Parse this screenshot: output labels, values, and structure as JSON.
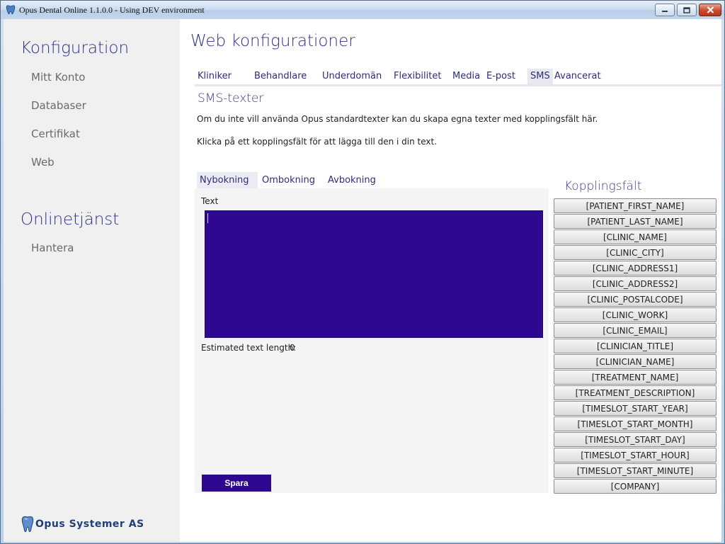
{
  "window": {
    "title": "Opus Dental Online 1.1.0.0 - Using DEV environment"
  },
  "sidebar": {
    "section1_heading": "Konfiguration",
    "section1_items": [
      "Mitt Konto",
      "Databaser",
      "Certifikat",
      "Web"
    ],
    "section2_heading": "Onlinetjänst",
    "section2_items": [
      "Hantera"
    ],
    "brand": "Opus Systemer AS"
  },
  "main": {
    "title": "Web konfigurationer",
    "tabs": [
      "Kliniker",
      "Behandlare",
      "Underdomän",
      "Flexibilitet",
      "Media",
      "E-post",
      "SMS",
      "Avancerat"
    ],
    "active_tab": "SMS",
    "section_title": "SMS-texter",
    "description1": "Om du inte vill använda Opus standardtexter kan du skapa egna texter med kopplingsfält här.",
    "description2": "Klicka på ett kopplingsfält för att lägga till den i din text.",
    "subtabs": [
      "Nybokning",
      "Ombokning",
      "Avbokning"
    ],
    "active_subtab": "Nybokning",
    "text_label": "Text",
    "text_value": "",
    "length_label": "Estimated text length:",
    "length_value": "0",
    "save_label": "Spara",
    "fields_title": "Kopplingsfält",
    "fields": [
      "[PATIENT_FIRST_NAME]",
      "[PATIENT_LAST_NAME]",
      "[CLINIC_NAME]",
      "[CLINIC_CITY]",
      "[CLINIC_ADDRESS1]",
      "[CLINIC_ADDRESS2]",
      "[CLINIC_POSTALCODE]",
      "[CLINIC_WORK]",
      "[CLINIC_EMAIL]",
      "[CLINICIAN_TITLE]",
      "[CLINICIAN_NAME]",
      "[TREATMENT_NAME]",
      "[TREATMENT_DESCRIPTION]",
      "[TIMESLOT_START_YEAR]",
      "[TIMESLOT_START_MONTH]",
      "[TIMESLOT_START_DAY]",
      "[TIMESLOT_START_HOUR]",
      "[TIMESLOT_START_MINUTE]",
      "[COMPANY]"
    ]
  },
  "colors": {
    "accent": "#2e0891",
    "heading": "#30308f"
  },
  "icons": {
    "app": "tooth-icon",
    "minimize": "minimize-icon",
    "maximize": "maximize-icon",
    "close": "close-icon",
    "brand": "tooth-logo-icon"
  }
}
